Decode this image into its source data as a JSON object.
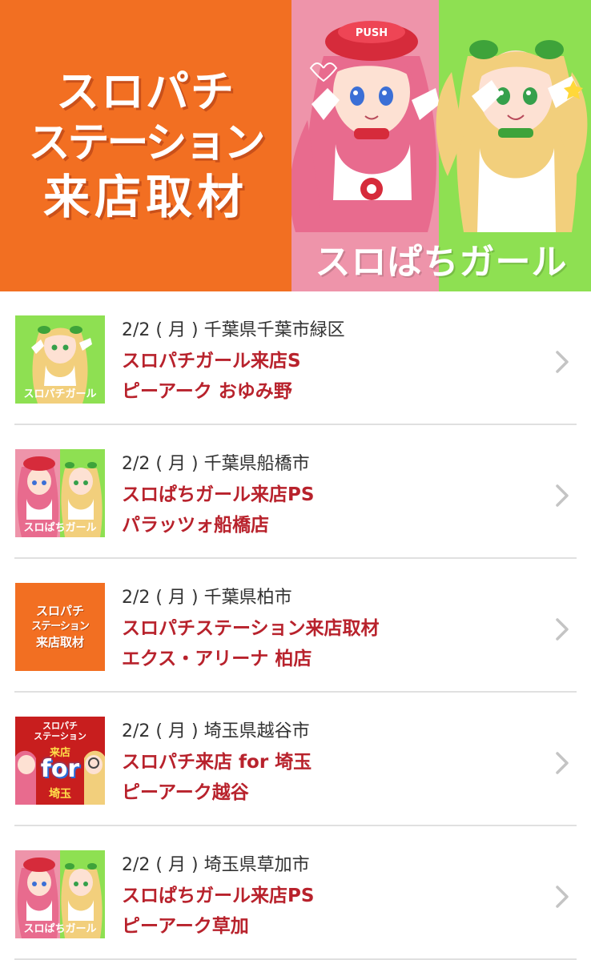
{
  "banner": {
    "left_line1": "スロパチ",
    "left_line2": "ステーション",
    "left_line3": "来店取材",
    "right_logo": "スロぱちガール",
    "hat_text": "PUSH"
  },
  "colors": {
    "orange": "#f26f22",
    "pink": "#ee94aa",
    "green": "#8ee052",
    "title_red": "#b8222c",
    "chevron_gray": "#c4c4c4"
  },
  "events": [
    {
      "date": "2/2",
      "weekday": "( 月 )",
      "location": "千葉県千葉市緑区",
      "title": "スロパチガール来店S",
      "venue": "ピーアーク おゆみ野",
      "thumb_type": "green-girl",
      "thumb_label": "スロパチガール"
    },
    {
      "date": "2/2",
      "weekday": "( 月 )",
      "location": "千葉県船橋市",
      "title": "スロぱちガール来店PS",
      "venue": "パラッツォ船橋店",
      "thumb_type": "two-girls",
      "thumb_label": "スロぱちガール"
    },
    {
      "date": "2/2",
      "weekday": "( 月 )",
      "location": "千葉県柏市",
      "title": "スロパチステーション来店取材",
      "venue": "エクス・アリーナ 柏店",
      "thumb_type": "orange-text",
      "thumb_line1": "スロパチ",
      "thumb_line2": "ステーション",
      "thumb_line3": "来店取材"
    },
    {
      "date": "2/2",
      "weekday": "( 月 )",
      "location": "埼玉県越谷市",
      "title": "スロパチ来店 for 埼玉",
      "venue": "ピーアーク越谷",
      "thumb_type": "saitama",
      "thumb_line1": "スロパチ",
      "thumb_line2": "ステーション",
      "thumb_line3": "来店",
      "thumb_line4": "for",
      "thumb_line5": "埼玉"
    },
    {
      "date": "2/2",
      "weekday": "( 月 )",
      "location": "埼玉県草加市",
      "title": "スロぱちガール来店PS",
      "venue": "ピーアーク草加",
      "thumb_type": "two-girls",
      "thumb_label": "スロぱちガール"
    }
  ],
  "icons": {
    "chevron": "chevron-right-icon"
  }
}
